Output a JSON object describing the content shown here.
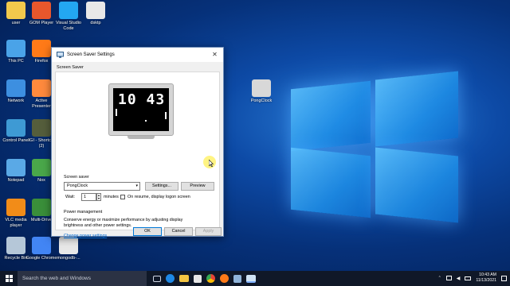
{
  "desktop": {
    "icons": [
      {
        "label": "user",
        "icon": "user-folder-icon",
        "color": "#f2c94c"
      },
      {
        "label": "GOM Player",
        "icon": "gom-player-icon",
        "color": "#e8572c"
      },
      {
        "label": "Visual Studio Code",
        "icon": "vscode-icon",
        "color": "#23a7f2"
      },
      {
        "label": "dsktp",
        "icon": "file-icon",
        "color": "#e8e8e8"
      },
      {
        "label": "This PC",
        "icon": "computer-icon",
        "color": "#4aa3e8"
      },
      {
        "label": "Firefox",
        "icon": "firefox-icon",
        "color": "#ff7a18"
      },
      {
        "label": "Network",
        "icon": "network-icon",
        "color": "#3d8fe0"
      },
      {
        "label": "Active Presenter",
        "icon": "activepresenter-icon",
        "color": "#ff8a3d"
      },
      {
        "label": "Control Panel",
        "icon": "control-panel-icon",
        "color": "#3e9ad4"
      },
      {
        "label": "IGI - Shortcut (2)",
        "icon": "game-shortcut-icon",
        "color": "#555e3c"
      },
      {
        "label": "Notepad",
        "icon": "notepad-icon",
        "color": "#5aa9e6"
      },
      {
        "label": "Nox",
        "icon": "nox-icon",
        "color": "#4aa84a"
      },
      {
        "label": "VLC media player",
        "icon": "vlc-icon",
        "color": "#f28c18"
      },
      {
        "label": "Multi-Drive",
        "icon": "nox-multidrive-icon",
        "color": "#3a8f3a"
      },
      {
        "label": "Recycle Bin",
        "icon": "recycle-bin-icon",
        "color": "#b5c7d8"
      },
      {
        "label": "Google Chrome",
        "icon": "chrome-icon",
        "color": "#4285f4"
      },
      {
        "label": "mongodb-...",
        "icon": "file-icon",
        "color": "#e8e8e8"
      },
      {
        "label": "PongClock",
        "icon": "pongclock-file-icon",
        "color": "#d8d8d8"
      }
    ]
  },
  "dialog": {
    "title": "Screen Saver Settings",
    "tab": "Screen Saver",
    "preview_time": "10 43",
    "screen_saver_group": "Screen saver",
    "selected_saver": "PongClock",
    "settings_label": "Settings...",
    "preview_label": "Preview",
    "wait_label": "Wait:",
    "wait_value": "1",
    "minutes_label": "minutes",
    "resume_label": "On resume, display logon screen",
    "power_group": "Power management",
    "power_desc": "Conserve energy or maximize performance by adjusting display brightness and other power settings.",
    "power_link": "Change power settings",
    "ok_label": "OK",
    "cancel_label": "Cancel",
    "apply_label": "Apply"
  },
  "taskbar": {
    "search_placeholder": "Search the web and Windows",
    "time": "10:43 AM",
    "date": "11/13/2021"
  },
  "colors": {
    "accent": "#0078d7",
    "link": "#0066cc",
    "taskbar": "#101828"
  }
}
